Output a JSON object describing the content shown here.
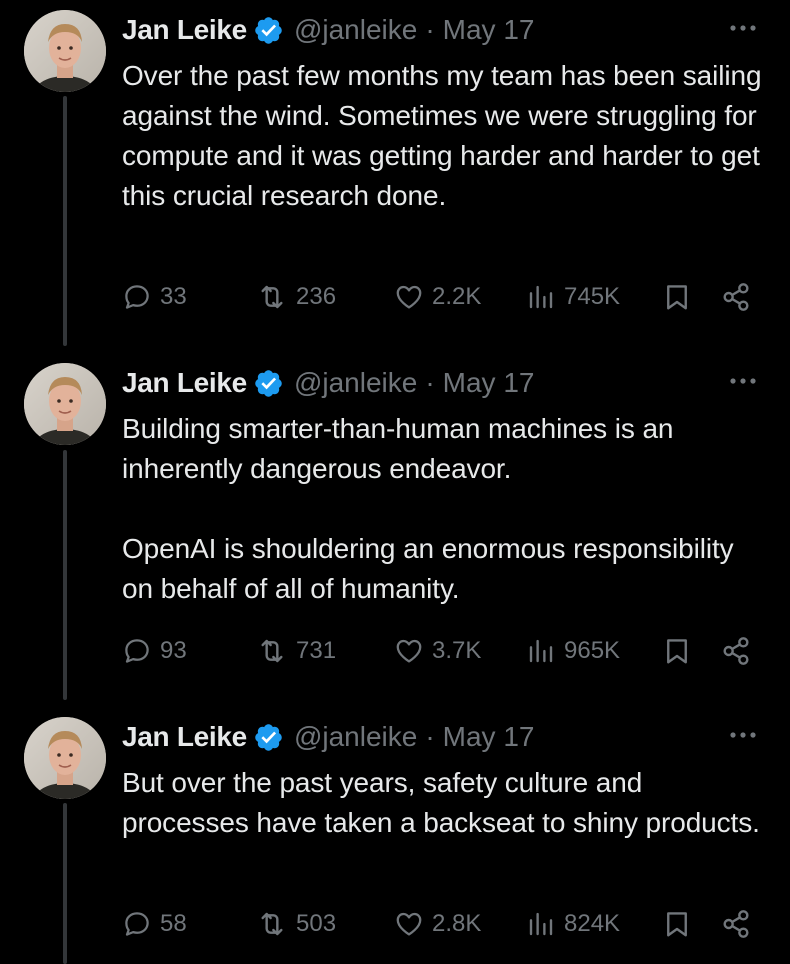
{
  "colors": {
    "background": "#000000",
    "text_primary": "#e7e9ea",
    "text_secondary": "#71767b",
    "verified_badge": "#1d9bf0",
    "thread_line": "#333639"
  },
  "tweets": [
    {
      "author_name": "Jan Leike",
      "handle": "@janleike",
      "separator": "·",
      "date": "May 17",
      "text": "Over the past few months my team has been sailing against the wind. Sometimes we were struggling for compute and it was getting harder and harder to get this crucial research done.",
      "replies": "33",
      "reposts": "236",
      "likes": "2.2K",
      "views": "745K"
    },
    {
      "author_name": "Jan Leike",
      "handle": "@janleike",
      "separator": "·",
      "date": "May 17",
      "text": "Building smarter-than-human machines is an inherently dangerous endeavor.\n\nOpenAI is shouldering an enormous responsibility on behalf of all of humanity.",
      "replies": "93",
      "reposts": "731",
      "likes": "3.7K",
      "views": "965K"
    },
    {
      "author_name": "Jan Leike",
      "handle": "@janleike",
      "separator": "·",
      "date": "May 17",
      "text": "But over the past years, safety culture and processes have taken a backseat to shiny products.",
      "replies": "58",
      "reposts": "503",
      "likes": "2.8K",
      "views": "824K"
    }
  ],
  "icons": {
    "verified": "verified-badge-icon",
    "more": "more-options-icon",
    "reply": "reply-icon",
    "repost": "repost-icon",
    "like": "like-icon",
    "views": "views-icon",
    "bookmark": "bookmark-icon",
    "share": "share-icon"
  }
}
